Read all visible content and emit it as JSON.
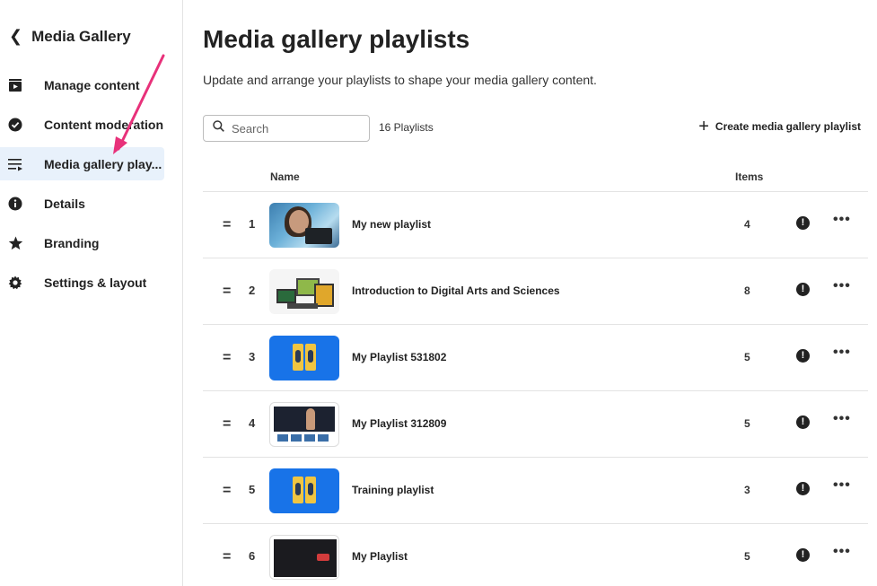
{
  "sidebar": {
    "back_label": "Media Gallery",
    "items": [
      {
        "label": "Manage content",
        "icon": "play-box-icon",
        "active": false
      },
      {
        "label": "Content moderation",
        "icon": "check-circle-icon",
        "active": false
      },
      {
        "label": "Media gallery play...",
        "icon": "playlist-icon",
        "active": true
      },
      {
        "label": "Details",
        "icon": "info-icon",
        "active": false
      },
      {
        "label": "Branding",
        "icon": "star-icon",
        "active": false
      },
      {
        "label": "Settings & layout",
        "icon": "gear-icon",
        "active": false
      }
    ]
  },
  "main": {
    "title": "Media gallery playlists",
    "subtitle": "Update and arrange your playlists to shape your media gallery content.",
    "search_placeholder": "Search",
    "count_label": "16 Playlists",
    "create_label": "Create media gallery playlist",
    "columns": {
      "name": "Name",
      "items": "Items"
    },
    "rows": [
      {
        "index": "1",
        "title": "My new playlist",
        "items": "4",
        "thumb": "photo"
      },
      {
        "index": "2",
        "title": "Introduction to Digital Arts and Sciences",
        "items": "8",
        "thumb": "devices"
      },
      {
        "index": "3",
        "title": "My Playlist 531802",
        "items": "5",
        "thumb": "blue"
      },
      {
        "index": "4",
        "title": "My Playlist 312809",
        "items": "5",
        "thumb": "screen"
      },
      {
        "index": "5",
        "title": "Training playlist",
        "items": "3",
        "thumb": "blue"
      },
      {
        "index": "6",
        "title": "My Playlist",
        "items": "5",
        "thumb": "dark"
      }
    ]
  },
  "colors": {
    "active_bg": "#e8f1fb",
    "annotation_arrow": "#e8317a",
    "text": "#222222"
  }
}
